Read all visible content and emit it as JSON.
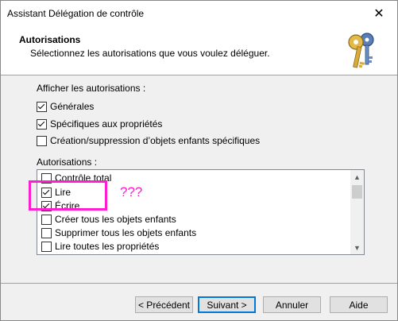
{
  "window": {
    "title": "Assistant Délégation de contrôle",
    "close_label": "✕"
  },
  "header": {
    "title": "Autorisations",
    "subtitle": "Sélectionnez les autorisations que vous voulez déléguer.",
    "icon": "keys-icon"
  },
  "show_section": {
    "label": "Afficher les autorisations :",
    "options": [
      {
        "label": "Générales",
        "checked": true
      },
      {
        "label": "Spécifiques aux propriétés",
        "checked": true
      },
      {
        "label": "Création/suppression d’objets enfants spécifiques",
        "checked": false
      }
    ]
  },
  "permissions": {
    "label": "Autorisations :",
    "items": [
      {
        "label": "Contrôle total",
        "checked": false
      },
      {
        "label": "Lire",
        "checked": true
      },
      {
        "label": "Écrire",
        "checked": true
      },
      {
        "label": "Créer tous les objets enfants",
        "checked": false
      },
      {
        "label": "Supprimer tous les objets enfants",
        "checked": false
      },
      {
        "label": "Lire toutes les propriétés",
        "checked": false
      }
    ]
  },
  "annotation": {
    "text": "???",
    "color": "#ff1fd0"
  },
  "buttons": {
    "back": "< Précédent",
    "next": "Suivant >",
    "cancel": "Annuler",
    "help": "Aide"
  }
}
